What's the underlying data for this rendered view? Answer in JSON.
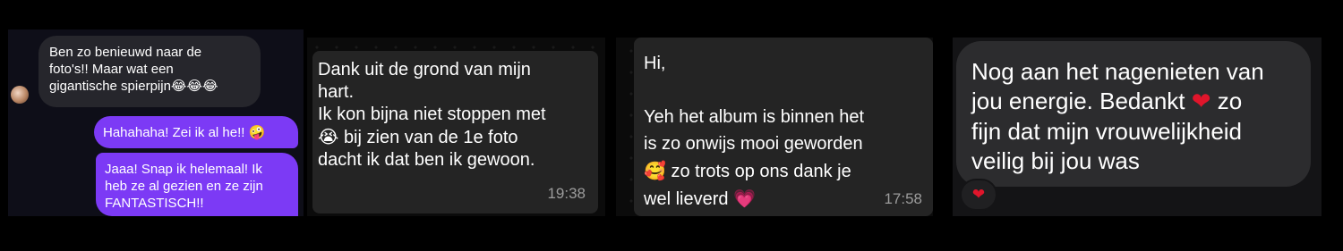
{
  "panels": [
    {
      "style": "instagram-dm",
      "incoming": {
        "lines": [
          "Ben zo benieuwd naar de",
          "foto's!! Maar wat een",
          "gigantische spierpijn"
        ],
        "emoji": "😂😂😂"
      },
      "outgoing": [
        {
          "text": "Hahahaha! Zei ik al he!!",
          "emoji": "🤪"
        },
        {
          "lines": [
            "Jaaa! Snap ik helemaal! Ik",
            "heb ze al gezien en ze zijn",
            "FANTASTISCH!!"
          ]
        }
      ],
      "colors": {
        "bubble_in": "#26262c",
        "bubble_out": "#7c3af5"
      }
    },
    {
      "style": "whatsapp",
      "lines": [
        "Dank uit de grond van mijn",
        "hart.",
        "Ik kon bijna  niet stoppen met",
        "bij zien van de 1e foto",
        "dacht ik dat ben ik gewoon."
      ],
      "emoji": "😭",
      "time": "19:38"
    },
    {
      "style": "whatsapp",
      "lines": [
        "Hi,",
        "",
        "Yeh het album is binnen het",
        "is zo onwijs mooi geworden",
        "zo trots op ons dank je",
        "wel lieverd"
      ],
      "emoji_face": "🥰",
      "emoji_heart": "💗",
      "time": "17:58"
    },
    {
      "style": "imessage",
      "lines": [
        "Nog aan het nagenieten van",
        "jou energie. Bedankt",
        "zo",
        "fijn dat mijn vrouwelijkheid",
        "veilig bij jou was"
      ],
      "heart": "❤",
      "reaction": "❤",
      "colors": {
        "heart": "#e0152b"
      }
    }
  ]
}
